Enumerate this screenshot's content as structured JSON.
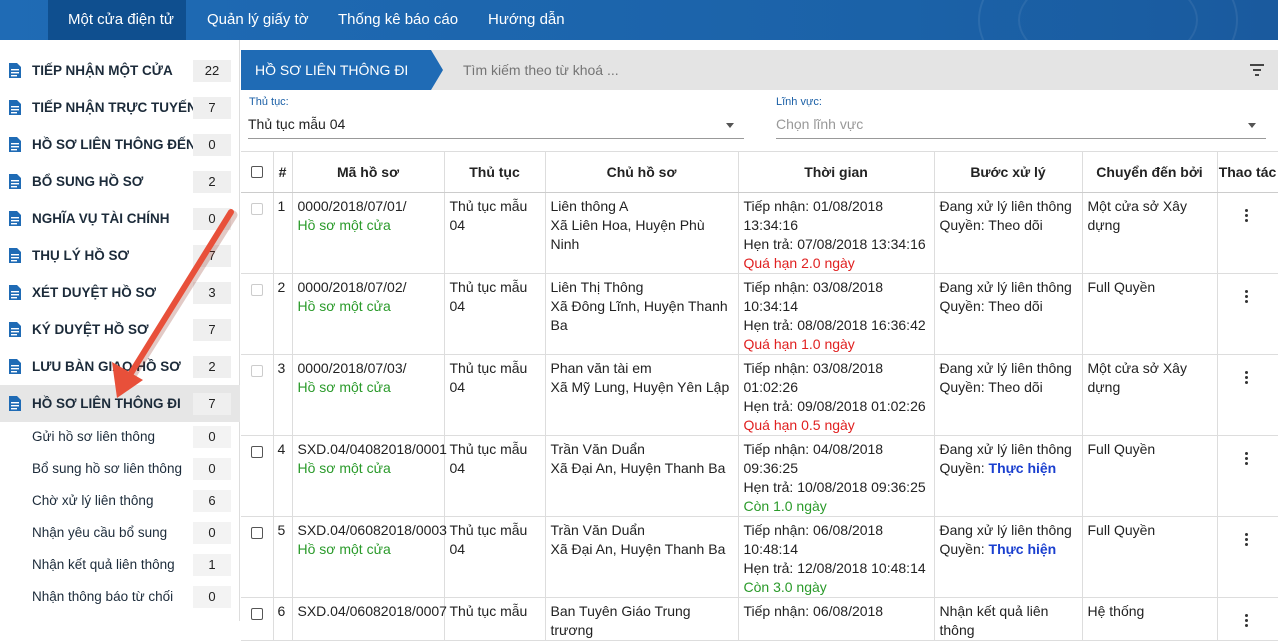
{
  "topnav": {
    "items": [
      {
        "label": "Một cửa điện tử"
      },
      {
        "label": "Quản lý giấy tờ"
      },
      {
        "label": "Thống kê báo cáo"
      },
      {
        "label": "Hướng dẫn"
      }
    ]
  },
  "sidebar": {
    "items": [
      {
        "label": "TIẾP NHẬN MỘT CỬA",
        "count": "22"
      },
      {
        "label": "TIẾP NHẬN TRỰC TUYẾN",
        "count": "7"
      },
      {
        "label": "HỒ SƠ LIÊN THÔNG ĐẾN",
        "count": "0"
      },
      {
        "label": "BỔ SUNG HỒ SƠ",
        "count": "2"
      },
      {
        "label": "NGHĨA VỤ TÀI CHÍNH",
        "count": "0"
      },
      {
        "label": "THỤ LÝ HỒ SƠ",
        "count": "7"
      },
      {
        "label": "XÉT DUYỆT HỒ SƠ",
        "count": "3"
      },
      {
        "label": "KÝ DUYỆT HỒ SƠ",
        "count": "7"
      },
      {
        "label": "LƯU BÀN GIAO HỒ SƠ",
        "count": "2"
      },
      {
        "label": "HỒ SƠ LIÊN THÔNG ĐI",
        "count": "7"
      }
    ],
    "subitems": [
      {
        "label": "Gửi hồ sơ liên thông",
        "count": "0"
      },
      {
        "label": "Bổ sung hồ sơ liên thông",
        "count": "0"
      },
      {
        "label": "Chờ xử lý liên thông",
        "count": "6"
      },
      {
        "label": "Nhận yêu cầu bổ sung",
        "count": "0"
      },
      {
        "label": "Nhận kết quả liên thông",
        "count": "1"
      },
      {
        "label": "Nhận thông báo từ chối",
        "count": "0"
      }
    ]
  },
  "main": {
    "title": "HỒ SƠ LIÊN THÔNG ĐI",
    "search_placeholder": "Tìm kiếm theo từ khoá ...",
    "filters": {
      "procedure_label": "Thủ tục:",
      "procedure_value": "Thủ tục mẫu 04",
      "field_label": "Lĩnh vực:",
      "field_placeholder": "Chọn lĩnh vực"
    },
    "table": {
      "headers": [
        "#",
        "Mã hồ sơ",
        "Thủ tục",
        "Chủ hồ sơ",
        "Thời gian",
        "Bước xử lý",
        "Chuyển đến bởi",
        "Thao tác"
      ],
      "rows": [
        {
          "num": "1",
          "code": "0000/2018/07/01/",
          "code_sub": "Hồ sơ một cửa",
          "proc": "Thủ tục mẫu 04",
          "owner": "Liên thông A",
          "owner_addr": "Xã Liên Hoa, Huyện Phù Ninh",
          "recv": "Tiếp nhận: 01/08/2018 13:34:16",
          "due": "Hẹn trả: 07/08/2018 13:34:16",
          "status": "Quá hạn 2.0 ngày",
          "step": "Đang xử lý liên thông",
          "perm_label": "Quyền:",
          "perm": "Theo dõi",
          "from": "Một cửa sở Xây dựng"
        },
        {
          "num": "2",
          "code": "0000/2018/07/02/",
          "code_sub": "Hồ sơ một cửa",
          "proc": "Thủ tục mẫu 04",
          "owner": "Liên Thị Thông",
          "owner_addr": "Xã Đông Lĩnh, Huyện Thanh Ba",
          "recv": "Tiếp nhận: 03/08/2018 10:34:14",
          "due": "Hẹn trả: 08/08/2018 16:36:42",
          "status": "Quá hạn 1.0 ngày",
          "step": "Đang xử lý liên thông",
          "perm_label": "Quyền:",
          "perm": "Theo dõi",
          "from": "Full Quyền"
        },
        {
          "num": "3",
          "code": "0000/2018/07/03/",
          "code_sub": "Hồ sơ một cửa",
          "proc": "Thủ tục mẫu 04",
          "owner": "Phan văn tài em",
          "owner_addr": "Xã Mỹ Lung, Huyện Yên Lập",
          "recv": "Tiếp nhận: 03/08/2018 01:02:26",
          "due": "Hẹn trả: 09/08/2018 01:02:26",
          "status": "Quá hạn 0.5 ngày",
          "step": "Đang xử lý liên thông",
          "perm_label": "Quyền:",
          "perm": "Theo dõi",
          "from": "Một cửa sở Xây dựng"
        },
        {
          "num": "4",
          "code": "SXD.04/04082018/0001",
          "code_sub": "Hồ sơ một cửa",
          "proc": "Thủ tục mẫu 04",
          "owner": "Trần Văn Duẩn",
          "owner_addr": "Xã Đại An, Huyện Thanh Ba",
          "recv": "Tiếp nhận: 04/08/2018 09:36:25",
          "due": "Hẹn trả: 10/08/2018 09:36:25",
          "status": "Còn 1.0 ngày",
          "step": "Đang xử lý liên thông",
          "perm_label": "Quyền:",
          "perm": "Thực hiện",
          "from": "Full Quyền"
        },
        {
          "num": "5",
          "code": "SXD.04/06082018/0003",
          "code_sub": "Hồ sơ một cửa",
          "proc": "Thủ tục mẫu 04",
          "owner": "Trần Văn Duẩn",
          "owner_addr": "Xã Đại An, Huyện Thanh Ba",
          "recv": "Tiếp nhận: 06/08/2018 10:48:14",
          "due": "Hẹn trả: 12/08/2018 10:48:14",
          "status": "Còn 3.0 ngày",
          "step": "Đang xử lý liên thông",
          "perm_label": "Quyền:",
          "perm": "Thực hiện",
          "from": "Full Quyền"
        },
        {
          "num": "6",
          "code": "SXD.04/06082018/0007",
          "code_sub": "",
          "proc": "Thủ tục mẫu",
          "owner": "Ban Tuyên Giáo Trung trương",
          "owner_addr": "",
          "recv": "Tiếp nhận: 06/08/2018",
          "due": "",
          "status": "",
          "step": "Nhận kết quả liên thông",
          "perm_label": "",
          "perm": "",
          "from": "Hệ thống"
        }
      ]
    }
  },
  "colors": {
    "primary": "#1f6bb5",
    "overdue": "#e02020",
    "ok": "#2a9a2a",
    "link": "#1a3fcf",
    "annotation_arrow": "#e8503a"
  }
}
